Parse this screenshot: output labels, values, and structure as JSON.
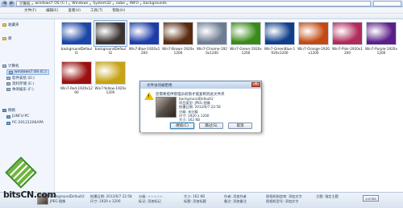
{
  "address_bar": {
    "crumbs": [
      "计算机",
      "windows7 OS (C:)",
      "Windows",
      "System32",
      "oobe",
      "INFO",
      "backgrounds"
    ]
  },
  "menu": [
    "文件(F)",
    "编辑(E)",
    "查看(V)",
    "工具(T)",
    "帮助(H)"
  ],
  "sidebar": {
    "items": [
      {
        "label": "收藏夹",
        "type": "fav"
      },
      {
        "label": "库",
        "type": "lib"
      },
      {
        "label": "计算机",
        "type": "drive"
      },
      {
        "label": "windows7 OS (C:)",
        "type": "drive",
        "selected": true
      },
      {
        "label": "软件安装 (D:)",
        "type": "drive"
      },
      {
        "label": "资料存储 (E:)",
        "type": "drive"
      },
      {
        "label": "休闲娱乐 (F:)",
        "type": "drive"
      },
      {
        "label": "网络",
        "type": "net"
      },
      {
        "label": "JUNFU-PC",
        "type": "net"
      },
      {
        "label": "PC-20121206APA",
        "type": "net"
      }
    ]
  },
  "files": [
    {
      "name": "backgroundDefault1",
      "color": "#1b45a6"
    },
    {
      "name": "backgroundDefault2",
      "color": "#3a3330",
      "selected": true
    },
    {
      "name": "Win7-Blue-1920x1200",
      "color": "#1d3ca8"
    },
    {
      "name": "Win7-Brown-1920x1200",
      "color": "#5a2a10"
    },
    {
      "name": "Win7-Chrome-1920x1200",
      "color": "#6e7c92"
    },
    {
      "name": "Win7-Green-1920x1200",
      "color": "#3a8a18"
    },
    {
      "name": "Win7-GreenBlue-1920x1200",
      "color": "#0f3e8a"
    },
    {
      "name": "Win7-Orange-1920x1200",
      "color": "#c24a12"
    },
    {
      "name": "Win7-Pink-1920x1200",
      "color": "#b02a5a"
    },
    {
      "name": "Win7-Purple-1920x1200",
      "color": "#5c1f8a"
    },
    {
      "name": "Win7-Red-1920x1200",
      "color": "#9a1010"
    },
    {
      "name": "Win7-Yellow-1920x1200",
      "color": "#c7a214"
    }
  ],
  "dialog": {
    "title": "文件访问被拒绝",
    "message": "您需要提供管理员权限才能复制到此文件夹",
    "filename": "backgroundDefault2",
    "type_line": "项目类型: JPEG 图像",
    "date_line": "拍摄日期: 2012/6/7 22:58",
    "rating_line": "分级: 未分级",
    "dim_line": "尺寸: 1920 x 1200",
    "size_line": "大小: 162 KB",
    "buttons": [
      "继续(C)",
      "跳过(S)",
      "取消"
    ]
  },
  "status": {
    "name": "backgroundDefault2",
    "type": "JPEG 图像",
    "date_label": "拍摄日期: 2012/6/7 22:58",
    "dim_label": "尺寸: 1920 x 1200",
    "rating_label": "分级: ☆☆☆☆☆",
    "size_label": "大小: 162 KB",
    "tag_label": "标记: 添加标记",
    "title_label": "标题: 添加标题",
    "author_label": "作者: 添加作者",
    "comment_label": "备注: 添加备注",
    "camera_label": "照相机制造商: 添加文字",
    "model_label": "照相机型号: 添加文字",
    "subject_label": "主题: 指定主题",
    "mini_btn": "0.07KS"
  },
  "watermark": "bitsCN.com"
}
